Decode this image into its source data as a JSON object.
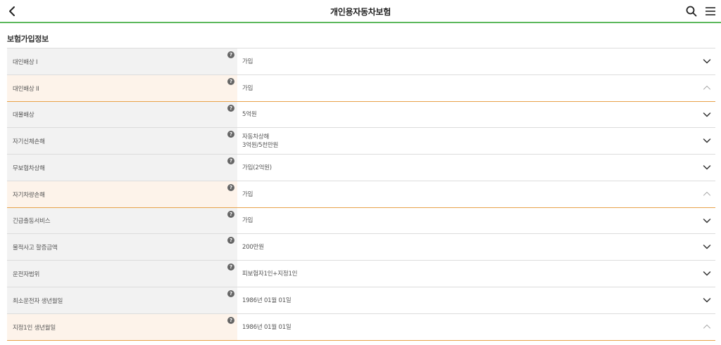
{
  "header": {
    "title": "개인용자동차보험",
    "back_icon": "chevron-left-icon",
    "search_icon": "search-icon",
    "menu_icon": "hamburger-menu-icon",
    "accent_color": "#5cb85c"
  },
  "section": {
    "title": "보험가입정보"
  },
  "rows": [
    {
      "label": "대인배상 I",
      "value": "가입",
      "value2": "",
      "expanded": false
    },
    {
      "label": "대인배상 II",
      "value": "가입",
      "value2": "",
      "expanded": true
    },
    {
      "label": "대물배상",
      "value": "5억원",
      "value2": "",
      "expanded": false
    },
    {
      "label": "자기신체손해",
      "value": "자동차상해",
      "value2": "3억원/5천만원",
      "expanded": false
    },
    {
      "label": "무보험차상해",
      "value": "가입(2억원)",
      "value2": "",
      "expanded": false
    },
    {
      "label": "자기차량손해",
      "value": "가입",
      "value2": "",
      "expanded": true
    },
    {
      "label": "긴급출동서비스",
      "value": "가입",
      "value2": "",
      "expanded": false
    },
    {
      "label": "물적사고 할증금액",
      "value": "200만원",
      "value2": "",
      "expanded": false
    },
    {
      "label": "운전자범위",
      "value": "피보험자1인+지정1인",
      "value2": "",
      "expanded": false
    },
    {
      "label": "최소운전자 생년월일",
      "value": "1986년 01월 01일",
      "value2": "",
      "expanded": false
    },
    {
      "label": "지정1인 생년월일",
      "value": "1986년 01월 01일",
      "value2": "",
      "expanded": true
    }
  ],
  "help_glyph": "?",
  "colors": {
    "expanded_border": "#e8a24a",
    "expanded_bg": "#fdf3ea",
    "label_bg": "#f2f2f2"
  }
}
